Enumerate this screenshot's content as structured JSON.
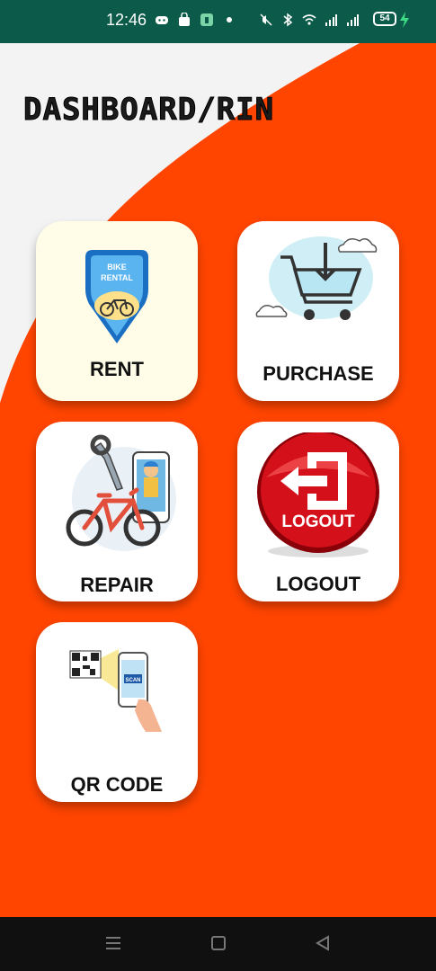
{
  "status_bar": {
    "time": "12:46",
    "battery": "54",
    "icons": [
      "discord-icon",
      "shopping-bag-icon",
      "app-notification-icon",
      "dot-icon",
      "mute-icon",
      "bluetooth-icon",
      "wifi-icon",
      "signal-icon",
      "signal-icon-2"
    ]
  },
  "dashboard": {
    "title": "DASHBOARD/RIN",
    "cards": [
      {
        "id": "rent",
        "label": "RENT",
        "badge_line1": "BIKE",
        "badge_line2": "RENTAL"
      },
      {
        "id": "purchase",
        "label": "PURCHASE"
      },
      {
        "id": "repair",
        "label": "REPAIR"
      },
      {
        "id": "logout",
        "label": "LOGOUT",
        "button_text": "LOGOUT"
      },
      {
        "id": "qr",
        "label": "QR CODE",
        "phone_text": "SCAN"
      }
    ]
  },
  "colors": {
    "background_orange": "#ff4500",
    "status_bar": "#0c5b4a",
    "card": "#ffffff",
    "rent_card": "#fffde8",
    "nav_bar": "#101010"
  },
  "nav_bar": {
    "buttons": [
      "menu-icon",
      "home-square-icon",
      "back-triangle-icon"
    ]
  }
}
